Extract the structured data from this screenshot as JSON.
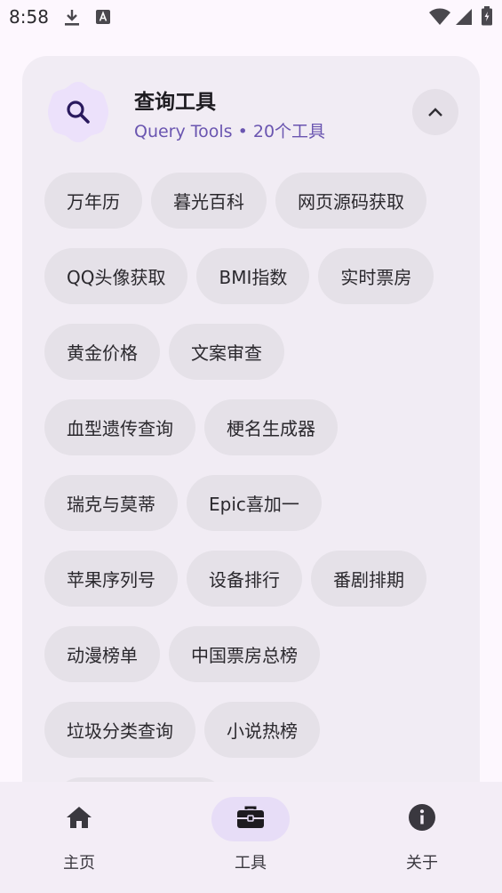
{
  "status_bar": {
    "time": "8:58"
  },
  "card": {
    "title": "查询工具",
    "subtitle": "Query Tools • 20个工具",
    "chips": [
      [
        "万年历",
        "暮光百科",
        "网页源码获取"
      ],
      [
        "QQ头像获取",
        "BMI指数",
        "实时票房"
      ],
      [
        "黄金价格",
        "文案审查"
      ],
      [
        "血型遗传查询",
        "梗名生成器"
      ],
      [
        "瑞克与莫蒂",
        "Epic喜加一"
      ],
      [
        "苹果序列号",
        "设备排行",
        "番剧排期"
      ],
      [
        "动漫榜单",
        "中国票房总榜"
      ],
      [
        "垃圾分类查询",
        "小说热榜"
      ]
    ]
  },
  "nav": {
    "home": "主页",
    "tools": "工具",
    "about": "关于"
  },
  "colors": {
    "accent": "#6a55b0",
    "badge_bg": "#ece1fb",
    "nav_active": "#e7ddf7"
  }
}
